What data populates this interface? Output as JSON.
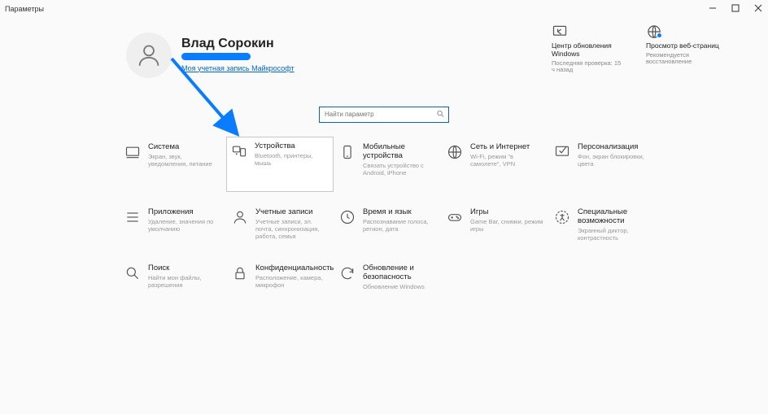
{
  "window": {
    "title": "Параметры"
  },
  "account": {
    "name": "Влад Сорокин",
    "ms_link": "Моя учетная запись Майкрософт"
  },
  "status": {
    "update": {
      "title": "Центр обновления Windows",
      "sub": "Последняя проверка: 15 ч назад"
    },
    "browser": {
      "title": "Просмотр веб-страниц",
      "sub": "Рекомендуется восстановление"
    }
  },
  "search": {
    "placeholder": "Найти параметр"
  },
  "tiles": [
    {
      "title": "Система",
      "desc": "Экран, звук, уведомления, питание"
    },
    {
      "title": "Устройства",
      "desc": "Bluetooth, принтеры, мышь"
    },
    {
      "title": "Мобильные устройства",
      "desc": "Связать устройство с Android, iPhone"
    },
    {
      "title": "Сеть и Интернет",
      "desc": "Wi-Fi, режим \"в самолете\", VPN"
    },
    {
      "title": "Персонализация",
      "desc": "Фон, экран блокировки, цвета"
    },
    {
      "title": "Приложения",
      "desc": "Удаление, значения по умолчанию"
    },
    {
      "title": "Учетные записи",
      "desc": "Учетные записи, эл. почта, синхронизация, работа, семья"
    },
    {
      "title": "Время и язык",
      "desc": "Распознавание голоса, регион, дата"
    },
    {
      "title": "Игры",
      "desc": "Game Bar, снимки, режим игры"
    },
    {
      "title": "Специальные возможности",
      "desc": "Экранный диктор, контрастность"
    },
    {
      "title": "Поиск",
      "desc": "Найти мои файлы, разрешения"
    },
    {
      "title": "Конфиденциальность",
      "desc": "Расположение, камера, микрофон"
    },
    {
      "title": "Обновление и безопасность",
      "desc": "Обновление Windows"
    }
  ]
}
